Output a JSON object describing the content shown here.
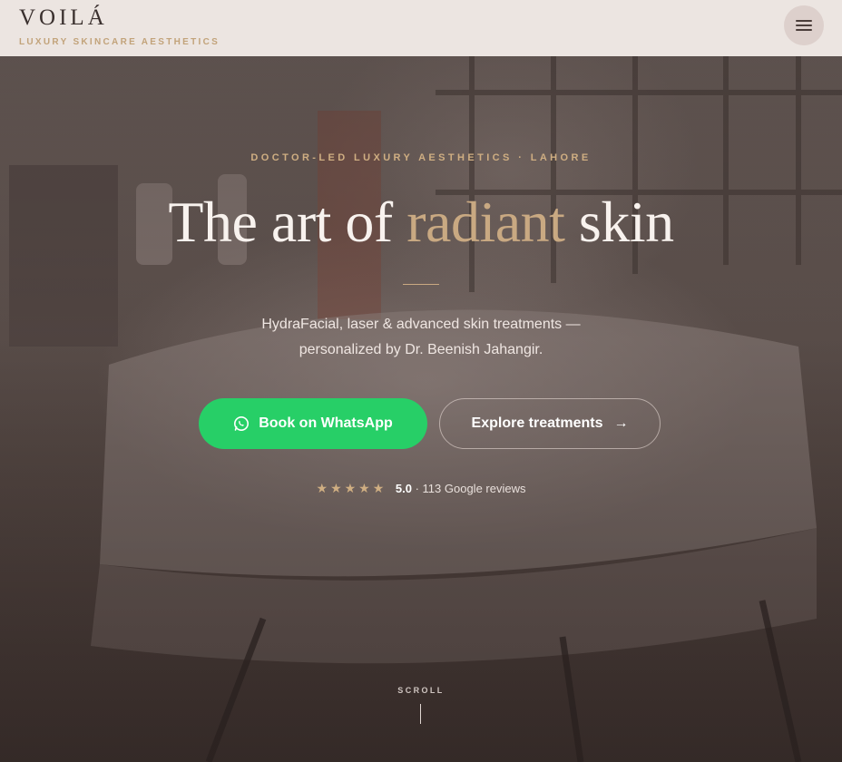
{
  "header": {
    "brand_name": "VOILÁ",
    "brand_tagline": "LUXURY SKINCARE AESTHETICS",
    "menu_icon": "hamburger-menu-icon"
  },
  "hero": {
    "eyebrow": "DOCTOR-LED LUXURY AESTHETICS · LAHORE",
    "headline_part1": "The art of ",
    "headline_accent": "radiant",
    "headline_part2": " skin",
    "subtitle_line1": "HydraFacial, laser & advanced skin treatments —",
    "subtitle_line2": "personalized by Dr. Beenish Jahangir.",
    "cta_primary": "Book on WhatsApp",
    "cta_primary_icon": "whatsapp-icon",
    "cta_secondary": "Explore treatments",
    "cta_secondary_arrow": "→",
    "rating_stars": "★★★★★",
    "rating_score": "5.0",
    "rating_text": " · 113 Google reviews",
    "scroll_label": "SCROLL"
  },
  "colors": {
    "accent_gold": "#c9a982",
    "whatsapp_green": "#27cf67",
    "header_bg": "#ece5e1"
  }
}
